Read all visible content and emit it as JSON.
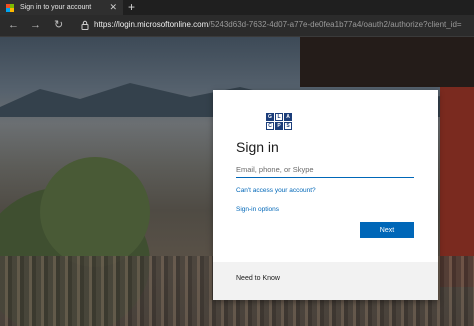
{
  "browser": {
    "tab": {
      "title": "Sign in to your account",
      "close": "✕"
    },
    "new_tab": "+",
    "nav": {
      "back": "←",
      "forward": "→",
      "refresh": "↻"
    },
    "url": {
      "host": "https://login.microsoftonline.com",
      "path": "/5243d63d-7632-4d07-a77e-de0fea1b77a4/oauth2/authorize?client_id="
    }
  },
  "signin": {
    "logo_letters": [
      "G",
      "L",
      "A",
      "C",
      "P",
      "S"
    ],
    "title": "Sign in",
    "email_placeholder": "Email, phone, or Skype",
    "cant_access": "Can't access your account?",
    "signin_options": "Sign-in options",
    "next": "Next",
    "footer": "Need to Know"
  },
  "colors": {
    "accent": "#0067b8",
    "ms_red": "#f25022",
    "ms_green": "#7fba00",
    "ms_blue": "#00a4ef",
    "ms_yellow": "#ffb900"
  }
}
